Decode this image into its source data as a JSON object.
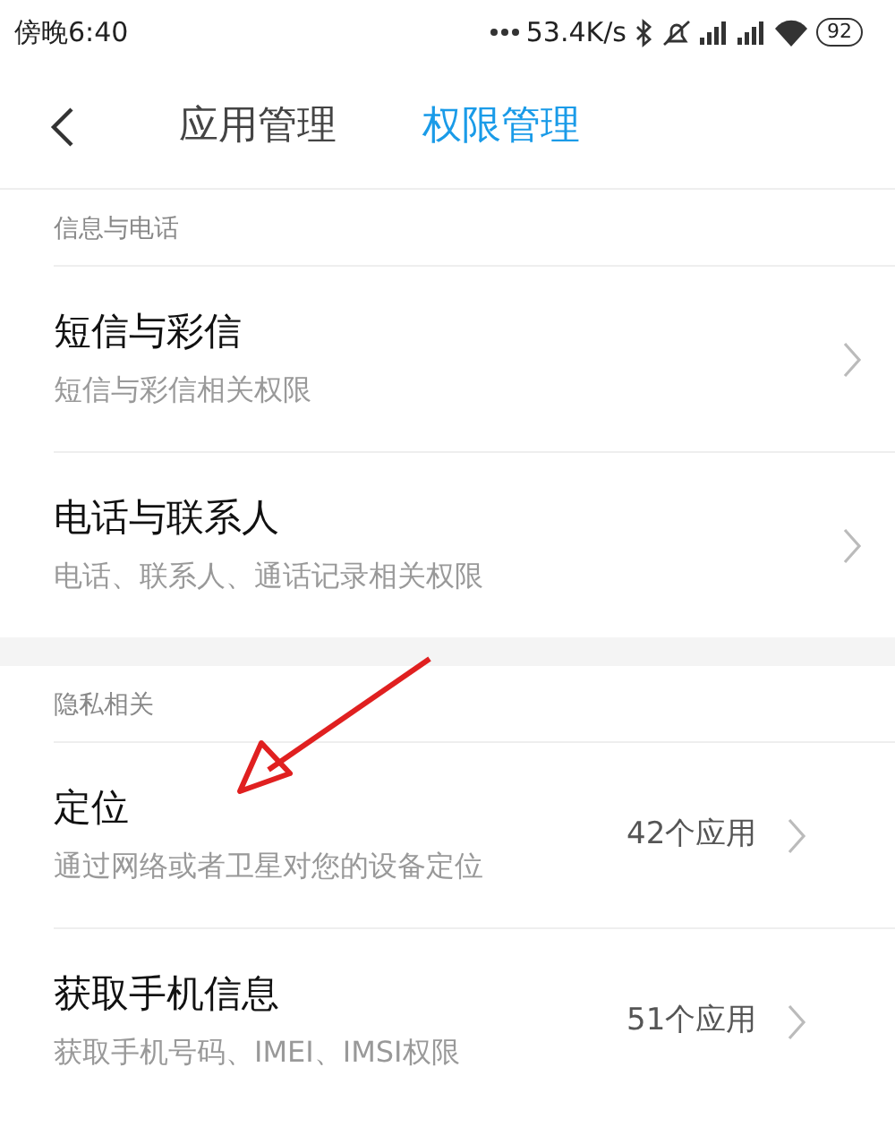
{
  "status_bar": {
    "time": "傍晚6:40",
    "network_speed": "53.4K/s",
    "battery": "92"
  },
  "header": {
    "tabs": [
      {
        "label": "应用管理",
        "selected": false
      },
      {
        "label": "权限管理",
        "selected": true
      }
    ]
  },
  "sections": [
    {
      "title": "信息与电话",
      "items": [
        {
          "title": "短信与彩信",
          "subtitle": "短信与彩信相关权限"
        },
        {
          "title": "电话与联系人",
          "subtitle": "电话、联系人、通话记录相关权限"
        }
      ]
    },
    {
      "title": "隐私相关",
      "items": [
        {
          "title": "定位",
          "subtitle": "通过网络或者卫星对您的设备定位",
          "count": "42个应用"
        },
        {
          "title": "获取手机信息",
          "subtitle": "获取手机号码、IMEI、IMSI权限",
          "count": "51个应用"
        }
      ]
    }
  ]
}
